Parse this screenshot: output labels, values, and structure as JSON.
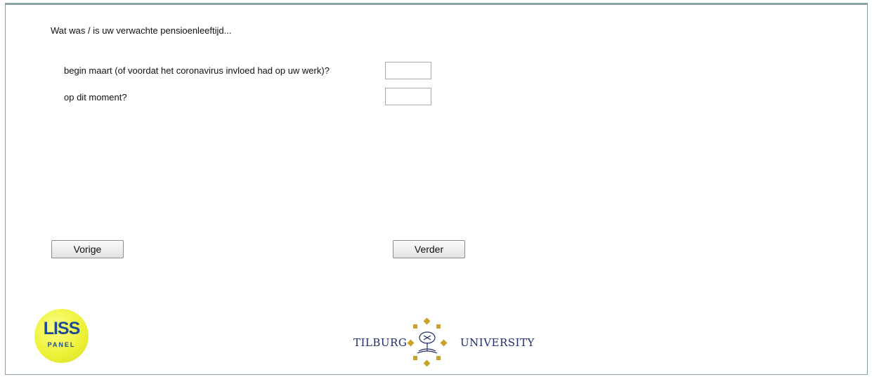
{
  "question": {
    "text": "Wat was / is uw verwachte pensioenleeftijd..."
  },
  "rows": [
    {
      "label": "begin maart (of voordat het coronavirus invloed had op uw werk)?",
      "value": ""
    },
    {
      "label": "op dit moment?",
      "value": ""
    }
  ],
  "nav": {
    "prev_label": "Vorige",
    "next_label": "Verder"
  },
  "logos": {
    "liss": {
      "main": "LISS",
      "sub": "PANEL"
    },
    "tilburg": {
      "left": "TILBURG",
      "right": "UNIVERSITY"
    }
  },
  "colors": {
    "frame": "#8aa0a6",
    "liss_yellow": "#eef23a",
    "liss_blue": "#1e4d8e",
    "tilburg_navy": "#1d2c6b",
    "tilburg_gold": "#c9a227"
  }
}
